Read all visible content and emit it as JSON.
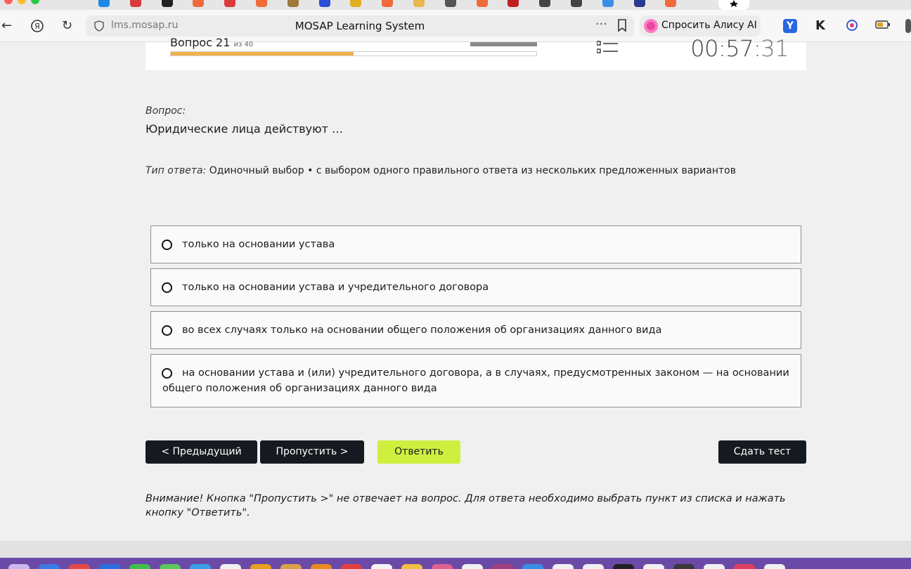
{
  "browser": {
    "url": "lms.mosap.ru",
    "page_title": "MOSAP Learning System",
    "menu_dots": "···",
    "alice_label": "Спросить Алису AI",
    "active_tab_icon": "star-icon"
  },
  "test": {
    "question_counter": "Вопрос 21",
    "question_counter_total": "из 40",
    "progress_fraction": 0.5,
    "timer_main": "00:57:",
    "timer_seconds": "31"
  },
  "question": {
    "label": "Вопрос:",
    "text": "Юридические лица действуют …"
  },
  "answer_type": {
    "label": "Тип ответа:",
    "value": " Одиночный выбор • с выбором одного правильного ответа из нескольких предложенных вариантов"
  },
  "options": [
    "только на основании устава",
    "только на основании устава и учредительного договора",
    "во всех случаях только на основании общего положения об организациях данного вида",
    "на основании устава и (или) учредительного договора, а в случаях, предусмотренных законом — на основании общего положения об организациях данного вида"
  ],
  "buttons": {
    "prev": "< Предыдущий",
    "skip": "Пропустить >",
    "answer": "Ответить",
    "submit": "Сдать тест"
  },
  "warning": "Внимание! Кнопка \"Пропустить >\" не отвечает на вопрос. Для ответа необходимо выбрать пункт из списка и нажать кнопку \"Ответить\".",
  "colors": {
    "progress": "#f2b04a",
    "answer_button": "#cfef3f",
    "dark_button": "#141a1f"
  }
}
